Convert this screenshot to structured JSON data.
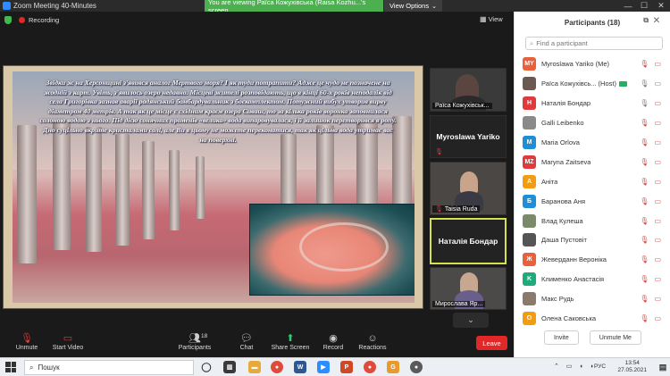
{
  "window": {
    "title": "Zoom Meeting 40-Minutes",
    "share_banner": "You are viewing Раїса Кожухівська (Raisa Kozhu...'s screen",
    "view_options": "View Options",
    "view_options_caret": "⌄",
    "minimize": "—",
    "maximize": "☐",
    "close": "✕"
  },
  "meeting": {
    "recording_label": "Recording",
    "view_label": "View"
  },
  "slide": {
    "text": "Звідки ж на Херсонщині з'явився аналог Мертвого моря? І як туди потрапити? Адже це чудо не позначене на жодній з карт. Увіть, з'явилось озеро недавно. Місцеві жителі розповідають, що в кінці 60-х років неподалік від села Григорівка зазнав аварії радянський бомбардувальник з боєкомплектом. Потужний вибух утворив вирву діаметром 40 метрів. А так як це місце є східним краєм озера Сиваш, то за кілька років воронка заповнилася солоною водою з нього. Під дією сонячних променів «велика» вода випаровувалася, і її залишок перетворився в ропу. Дно суцільно вкрите кристалами солі, але Ви в цьому не можете переконатися, так як цільна вода утримає вас на поверхні."
  },
  "tiles": [
    {
      "name": "Раїса Кожухівськ...",
      "type": "video"
    },
    {
      "name": "Myroslawa Yariko",
      "type": "name"
    },
    {
      "name": "Taisia Ruda",
      "type": "video"
    },
    {
      "name": "Наталія Бондар",
      "type": "name"
    },
    {
      "name": "Мирослава Яр...",
      "type": "video"
    }
  ],
  "toolbar": {
    "unmute": "Unmute",
    "start_video": "Start Video",
    "participants": "Participants",
    "participants_count": "18",
    "chat": "Chat",
    "share_screen": "Share Screen",
    "record": "Record",
    "reactions": "Reactions",
    "leave": "Leave"
  },
  "panel": {
    "title": "Participants (18)",
    "search_placeholder": "Find a participant",
    "invite": "Invite",
    "unmute_me": "Unmute Me",
    "participants": [
      {
        "initials": "MY",
        "color": "#e8603c",
        "name": "Myroslawa Yariko (Me)",
        "mic": "off",
        "cam": "off"
      },
      {
        "initials": "",
        "color": "#6a5a52",
        "name": "Раїса Кожухівсь...",
        "host": "(Host)",
        "mic": "on",
        "cam": "on"
      },
      {
        "initials": "H",
        "color": "#e03a3a",
        "name": "Наталія Бондар",
        "mic": "on",
        "cam": "off"
      },
      {
        "initials": "",
        "color": "#8a8a8a",
        "name": "Galli Leibenko",
        "mic": "off",
        "cam": "off"
      },
      {
        "initials": "M",
        "color": "#1e8fd6",
        "name": "Maria Orlova",
        "mic": "off",
        "cam": "off"
      },
      {
        "initials": "MZ",
        "color": "#e03a3a",
        "name": "Maryna Zaitseva",
        "mic": "off",
        "cam": "off"
      },
      {
        "initials": "A",
        "color": "#f39c12",
        "name": "Аніта",
        "mic": "off",
        "cam": "off"
      },
      {
        "initials": "Б",
        "color": "#1e8fd6",
        "name": "Баранова Аня",
        "mic": "off",
        "cam": "off"
      },
      {
        "initials": "",
        "color": "#7a8a6a",
        "name": "Влад Кулеша",
        "mic": "off",
        "cam": "off"
      },
      {
        "initials": "",
        "color": "#555555",
        "name": "Даша Пустовіт",
        "mic": "off",
        "cam": "off"
      },
      {
        "initials": "Ж",
        "color": "#e8603c",
        "name": "Жеверданн Вероніка",
        "mic": "off",
        "cam": "off"
      },
      {
        "initials": "K",
        "color": "#1eaa7a",
        "name": "Клименко Анастасія",
        "mic": "off",
        "cam": "off"
      },
      {
        "initials": "",
        "color": "#8a7a6a",
        "name": "Макс Рудь",
        "mic": "off",
        "cam": "off"
      },
      {
        "initials": "O",
        "color": "#f39c12",
        "name": "Олена Саковська",
        "mic": "off",
        "cam": "off"
      }
    ]
  },
  "taskbar": {
    "search_label": "Пошук",
    "time": "13:54",
    "date": "27.05.2021",
    "lang": "РУС"
  }
}
